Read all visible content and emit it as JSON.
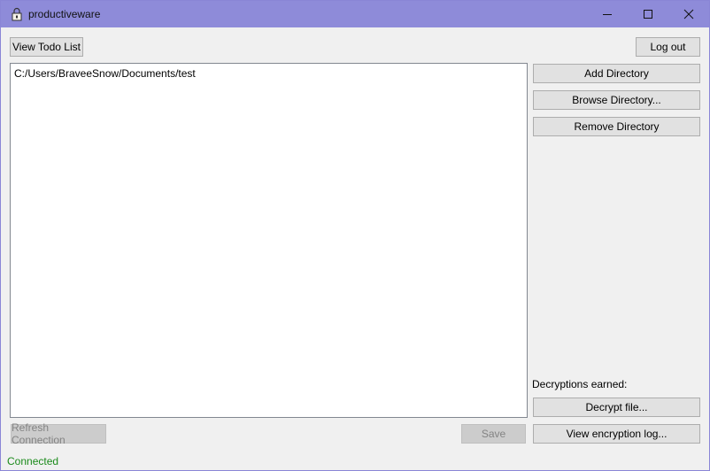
{
  "window": {
    "title": "productiveware",
    "icon": "lock-icon",
    "controls": [
      "minimize-icon",
      "maximize-icon",
      "close-icon"
    ]
  },
  "toolbar": {
    "view_todo_label": "View Todo List",
    "logout_label": "Log out"
  },
  "directories": {
    "items": [
      "C:/Users/BraveeSnow/Documents/test"
    ]
  },
  "sidebar": {
    "add_label": "Add Directory",
    "browse_label": "Browse Directory...",
    "remove_label": "Remove Directory",
    "decryptions_label": "Decryptions earned:",
    "decrypt_label": "Decrypt file...",
    "view_log_label": "View encryption log..."
  },
  "bottom": {
    "refresh_label": "Refresh Connection",
    "save_label": "Save"
  },
  "status": {
    "text": "Connected",
    "color": "#1a8a1a"
  }
}
